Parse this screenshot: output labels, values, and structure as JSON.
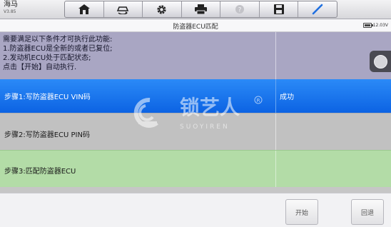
{
  "app": {
    "name": "海马",
    "version": "V3.85"
  },
  "toolbar": {
    "items": [
      {
        "icon": "home-icon"
      },
      {
        "icon": "vehicle-swap-icon"
      },
      {
        "icon": "gear-icon"
      },
      {
        "icon": "printer-icon"
      },
      {
        "icon": "help-icon"
      },
      {
        "icon": "save-icon"
      },
      {
        "icon": "pen-icon"
      }
    ]
  },
  "header": {
    "title": "防盗器ECU匹配",
    "battery_voltage": "12.03V"
  },
  "info": {
    "lines": [
      "需要满足以下条件才可执行此功能:",
      "  1.防盗器ECU是全新的或者已复位;",
      "  2.发动机ECU处于匹配状态;",
      "点击【开始】自动执行."
    ]
  },
  "steps": [
    {
      "label": "步骤1:写防盗器ECU VIN码",
      "status": "成功"
    },
    {
      "label": "步骤2:写防盗器ECU PIN码",
      "status": ""
    },
    {
      "label": "步骤3:匹配防盗器ECU",
      "status": ""
    }
  ],
  "buttons": {
    "start": "开始",
    "back": "回退"
  },
  "watermark": {
    "cn": "锁艺人",
    "en": "SUOYIREN"
  },
  "colors": {
    "info_bg": "#a9a6c3",
    "step_selected": "#1577ee",
    "step_pending": "#c1c1c1",
    "step_active": "#b3dca7"
  }
}
